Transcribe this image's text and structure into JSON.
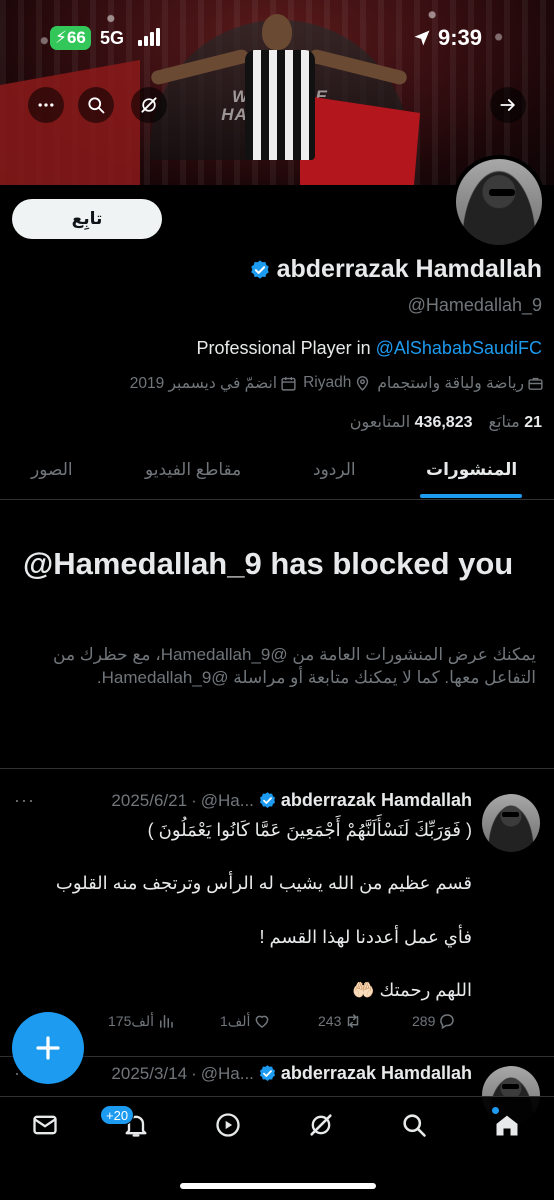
{
  "status_bar": {
    "battery": "66",
    "network": "5G",
    "time": "9:39"
  },
  "profile": {
    "name": "abderrazak Hamdallah",
    "handle": "@Hamedallah_9",
    "follow_label": "تابِع",
    "bio_prefix": "Professional Player in ",
    "bio_mention": "@AlShababSaudiFC",
    "category": "رياضة ولياقة واستجمام",
    "location": "Riyadh",
    "joined": "انضمّ في ديسمبر 2019",
    "following_count": "21",
    "following_label": "متابَع",
    "followers_count": "436,823",
    "followers_label": "المتابعون"
  },
  "tabs": [
    "المنشورات",
    "الردود",
    "مقاطع الفيديو",
    "الصور"
  ],
  "blocked": {
    "title": "@Hamedallah_9 has blocked you",
    "description": "يمكنك عرض المنشورات العامة من @Hamedallah_9، مع حظرك من التفاعل معها. كما لا يمكنك متابعة أو مراسلة @Hamedallah_9."
  },
  "tweets": [
    {
      "author": "abderrazak Hamdallah",
      "handle_trunc": "@Ha...",
      "date": "2025/6/21",
      "lines": [
        "( فَوَرَبِّكَ لَنَسْأَلَنَّهُمْ أَجْمَعِينَ عَمَّا كَانُوا يَعْمَلُونَ )",
        "قسم عظيم من الله يشيب له الرأس وترتجف منه القلوب",
        "فأي عمل أعددنا لهذا القسم !",
        "اللهم رحمتك 🤲🏻"
      ],
      "replies": "289",
      "reposts": "243",
      "likes": "1ألف",
      "views": "175ألف"
    },
    {
      "author": "abderrazak Hamdallah",
      "handle_trunc": "@Ha...",
      "date": "2025/3/14"
    }
  ],
  "more_glyph": "···",
  "fab_icon": "plus-icon",
  "bottom_nav": {
    "notifications_badge": "+20"
  },
  "colors": {
    "accent": "#1d9bf0",
    "background": "#000000",
    "muted": "#71767b",
    "text": "#e7e9ea"
  }
}
